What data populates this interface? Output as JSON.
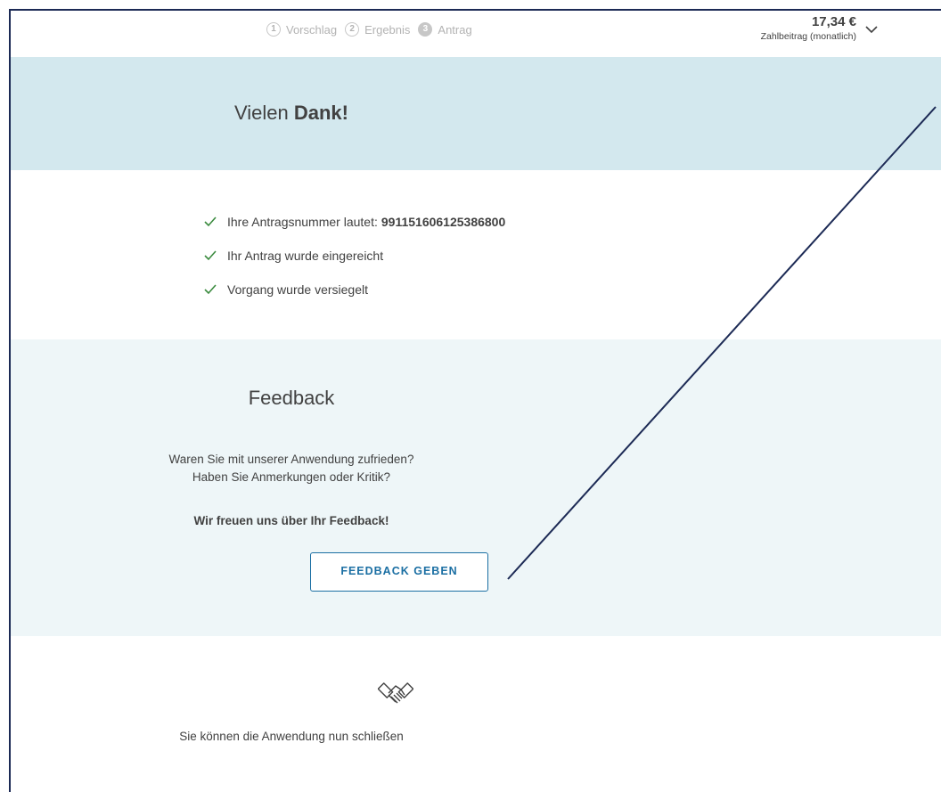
{
  "header": {
    "steps": [
      {
        "num": "1",
        "label": "Vorschlag"
      },
      {
        "num": "2",
        "label": "Ergebnis"
      },
      {
        "num": "3",
        "label": "Antrag"
      }
    ],
    "price": "17,34 €",
    "price_label": "Zahlbeitrag (monatlich)"
  },
  "banner": {
    "title_prefix": "Vielen ",
    "title_bold": "Dank!"
  },
  "confirmation": {
    "item1_prefix": "Ihre Antragsnummer lautet: ",
    "item1_value": "991151606125386800",
    "item2": "Ihr Antrag wurde eingereicht",
    "item3": "Vorgang wurde versiegelt"
  },
  "feedback": {
    "title": "Feedback",
    "line1": "Waren Sie mit unserer Anwendung zufrieden?",
    "line2": "Haben Sie Anmerkungen oder Kritik?",
    "cta": "Wir freuen uns über Ihr Feedback!",
    "button_label": "FEEDBACK GEBEN"
  },
  "closing": {
    "text": "Sie können die Anwendung nun schließen",
    "icon": "handshake-icon"
  },
  "colors": {
    "banner_bg": "#d3e8ee",
    "feedback_bg": "#eef6f8",
    "accent": "#1b6fa3",
    "check": "#3a8a3e",
    "annotation": "#1c2a55"
  }
}
